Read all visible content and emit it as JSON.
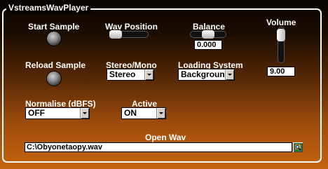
{
  "window": {
    "title": "VstreamsWavPlayer"
  },
  "controls": {
    "start_sample": {
      "label": "Start Sample"
    },
    "wav_position": {
      "label": "Wav Position",
      "level": 0.0
    },
    "balance": {
      "label": "Balance",
      "value": "0.000",
      "level": 0.5
    },
    "volume": {
      "label": "Volume",
      "value": "9.00",
      "level": 0.9
    },
    "reload_sample": {
      "label": "Reload Sample"
    },
    "stereo_mono": {
      "label": "Stereo/Mono",
      "selected": "Stereo"
    },
    "loading_system": {
      "label": "Loading System",
      "selected": "Background"
    },
    "normalise": {
      "label": "Normalise (dBFS)",
      "selected": "OFF"
    },
    "active": {
      "label": "Active",
      "selected": "ON"
    },
    "open_wav": {
      "label": "Open Wav",
      "path": "C:\\Obyonetaopy.wav",
      "icon": "folder-browse-icon"
    }
  },
  "colors": {
    "background_top": "#070300",
    "background_bottom": "#c4640f",
    "text": "#ffffff"
  }
}
